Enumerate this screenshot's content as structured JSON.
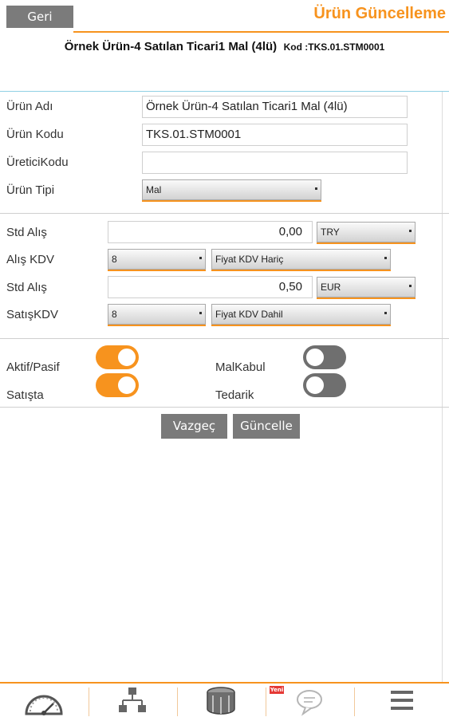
{
  "header": {
    "back_label": "Geri",
    "title": "Ürün Güncelleme",
    "product_name": "Örnek Ürün-4 Satılan Ticari1 Mal (4lü)",
    "product_code": "Kod :TKS.01.STM0001"
  },
  "form": {
    "name_label": "Ürün Adı",
    "name_value": "Örnek Ürün-4 Satılan Ticari1 Mal (4lü)",
    "code_label": "Ürün Kodu",
    "code_value": "TKS.01.STM0001",
    "mfr_label": "ÜreticiKodu",
    "mfr_value": "",
    "type_label": "Ürün Tipi",
    "type_value": "Mal"
  },
  "pricing": {
    "buy_label": "Std Alış",
    "buy_value": "0,00",
    "buy_currency": "TRY",
    "buy_vat_label": "Alış KDV",
    "buy_vat": "8",
    "buy_vat_mode": "Fiyat KDV Hariç",
    "sell_label": "Std Alış",
    "sell_value": "0,50",
    "sell_currency": "EUR",
    "sell_vat_label": "SatışKDV",
    "sell_vat": "8",
    "sell_vat_mode": "Fiyat KDV Dahil"
  },
  "toggles": {
    "active_label": "Aktif/Pasif",
    "active_on": true,
    "onsale_label": "Satışta",
    "onsale_on": true,
    "goods_receipt_label": "MalKabul",
    "goods_receipt_on": false,
    "supply_label": "Tedarik",
    "supply_on": false
  },
  "actions": {
    "cancel_label": "Vazgeç",
    "update_label": "Güncelle"
  },
  "bottom_nav": {
    "new_badge": "Yeni",
    "icons": [
      "dashboard-gauge-icon",
      "hierarchy-icon",
      "products-box-icon",
      "messages-icon",
      "menu-icon"
    ]
  },
  "colors": {
    "accent": "#f7931e",
    "button_gray": "#7a7a7a",
    "toggle_off": "#6f6f6f",
    "divider_blue": "#8fd0e4"
  }
}
